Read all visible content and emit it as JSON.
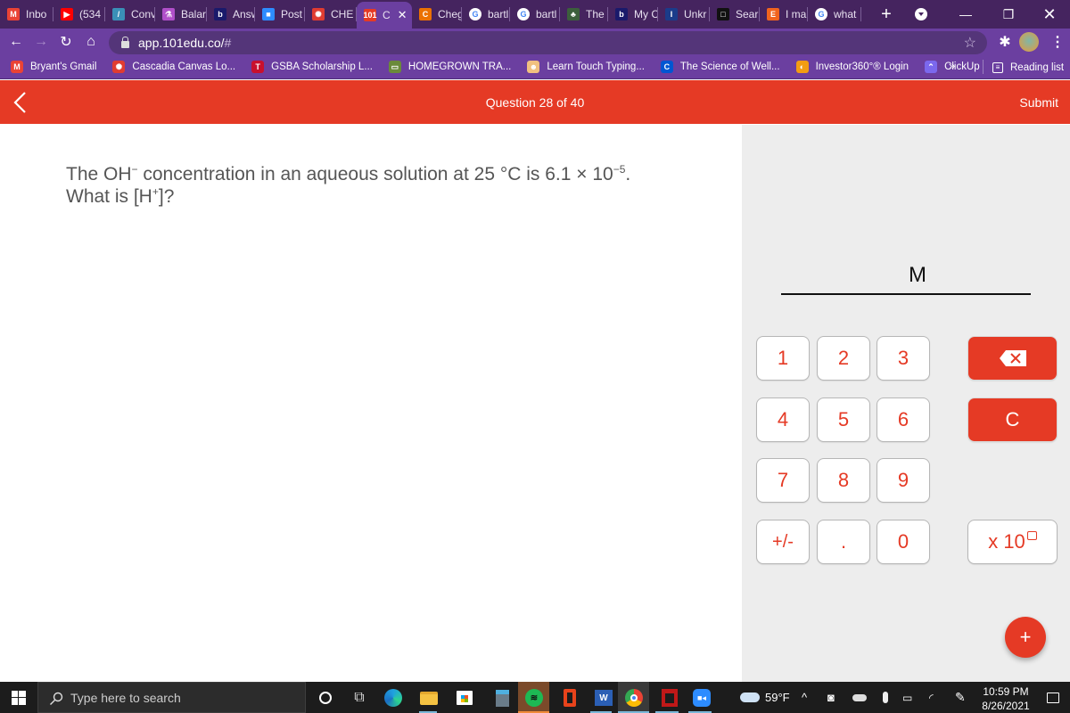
{
  "browser": {
    "tabs": [
      {
        "label": "Inbo",
        "icon": "gmail-icon",
        "color": "#ea4335",
        "glyph": "M"
      },
      {
        "label": "(534",
        "icon": "youtube-icon",
        "color": "#ff0000",
        "glyph": "▶"
      },
      {
        "label": "Conv",
        "icon": "conversion-icon",
        "color": "#3a8fb7",
        "glyph": "/"
      },
      {
        "label": "Balar",
        "icon": "flask-icon",
        "color": "#b04fc9",
        "glyph": "⚗"
      },
      {
        "label": "Answ",
        "icon": "brainly-icon",
        "color": "#1a1a6b",
        "glyph": "b"
      },
      {
        "label": "Post",
        "icon": "zoom-icon",
        "color": "#2d8cff",
        "glyph": "■"
      },
      {
        "label": "CHE",
        "icon": "canvas-icon",
        "color": "#e03c31",
        "glyph": "✺"
      },
      {
        "label": "C",
        "icon": "101edu-icon",
        "color": "#e53a25",
        "glyph": "101",
        "active": true
      },
      {
        "label": "Cheg",
        "icon": "chegg-icon",
        "color": "#eb7100",
        "glyph": "C"
      },
      {
        "label": "bartl",
        "icon": "google-icon",
        "color": "#ffffff",
        "glyph": "G"
      },
      {
        "label": "bartl",
        "icon": "google-icon",
        "color": "#ffffff",
        "glyph": "G"
      },
      {
        "label": "The",
        "icon": "leaf-icon",
        "color": "#3c5f3c",
        "glyph": "♣"
      },
      {
        "label": "My C",
        "icon": "brainly-icon",
        "color": "#1a1a6b",
        "glyph": "b"
      },
      {
        "label": "Unkr",
        "icon": "unknown-icon",
        "color": "#1b3c8a",
        "glyph": "I"
      },
      {
        "label": "Sear",
        "icon": "square-icon",
        "color": "#111111",
        "glyph": "□"
      },
      {
        "label": "I ma",
        "icon": "etsy-icon",
        "color": "#f1641e",
        "glyph": "E"
      },
      {
        "label": "what",
        "icon": "google-icon",
        "color": "#ffffff",
        "glyph": "G"
      }
    ],
    "new_tab": "+",
    "url_host": "app.101edu.co/",
    "url_hash": "#",
    "bookmarks": [
      {
        "label": "Bryant's Gmail",
        "icon": "gmail-icon",
        "color": "#ea4335",
        "glyph": "M"
      },
      {
        "label": "Cascadia Canvas Lo...",
        "icon": "canvas-icon",
        "color": "#e03c31",
        "glyph": "✺"
      },
      {
        "label": "GSBA Scholarship L...",
        "icon": "gsba-icon",
        "color": "#c8102e",
        "glyph": "T"
      },
      {
        "label": "HOMEGROWN TRA...",
        "icon": "homegrown-icon",
        "color": "#6b8a3a",
        "glyph": "▭"
      },
      {
        "label": "Learn Touch Typing...",
        "icon": "typing-icon",
        "color": "#f0c080",
        "glyph": "☻"
      },
      {
        "label": "The Science of Well...",
        "icon": "coursera-icon",
        "color": "#0056d2",
        "glyph": "C"
      },
      {
        "label": "Investor360°® Login",
        "icon": "investor-icon",
        "color": "#f39c12",
        "glyph": "◐"
      },
      {
        "label": "ClickUp",
        "icon": "clickup-icon",
        "color": "#7b68ee",
        "glyph": "⌃"
      }
    ],
    "overflow": "»",
    "reading_list": "Reading list"
  },
  "app": {
    "question_counter": "Question 28 of 40",
    "submit": "Submit",
    "question": {
      "line1_a": "The OH",
      "line1_sup1": "−",
      "line1_b": " concentration in an aqueous solution at 25 °C is 6.1 × 10",
      "line1_sup2": "−5",
      "line1_c": ".",
      "line2_a": "What is [H",
      "line2_sup": "+",
      "line2_b": "]?"
    },
    "answer_value": "",
    "units": "M",
    "keypad": {
      "keys": [
        "1",
        "2",
        "3",
        "4",
        "5",
        "6",
        "7",
        "8",
        "9",
        "+/-",
        ".",
        "0"
      ],
      "backspace": "backspace",
      "clear": "C",
      "exponent": "x 10"
    },
    "fab": "+"
  },
  "taskbar": {
    "search_placeholder": "Type here to search",
    "weather": "59°F",
    "time": "10:59 PM",
    "date": "8/26/2021"
  }
}
